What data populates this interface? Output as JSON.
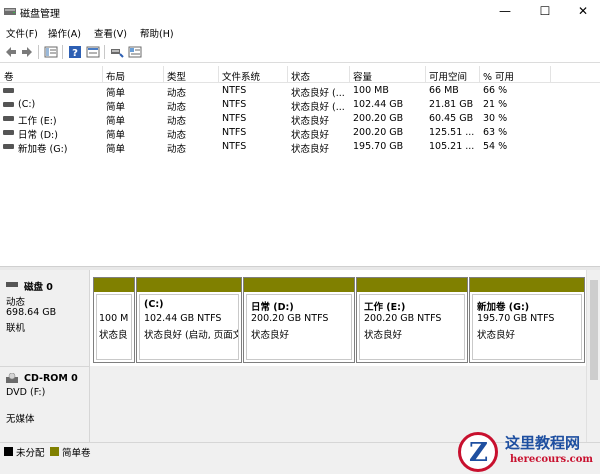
{
  "window": {
    "title": "磁盘管理",
    "minimize_glyph": "—",
    "maximize_glyph": "☐",
    "close_glyph": "✕"
  },
  "menu": [
    {
      "label": "文件(F)"
    },
    {
      "label": "操作(A)"
    },
    {
      "label": "查看(V)"
    },
    {
      "label": "帮助(H)"
    }
  ],
  "toolbar": {
    "icons": [
      "back-arrow-icon",
      "forward-arrow-icon",
      "properties-icon",
      "help-icon",
      "refresh-icon",
      "connect-icon",
      "options-icon"
    ]
  },
  "list": {
    "columns": [
      "卷",
      "布局",
      "类型",
      "文件系统",
      "状态",
      "容量",
      "可用空间",
      "% 可用"
    ],
    "rows": [
      {
        "volume": "",
        "layout": "简单",
        "type": "动态",
        "fs": "NTFS",
        "status": "状态良好 (...",
        "capacity": "100 MB",
        "free": "66 MB",
        "pct": "66 %"
      },
      {
        "volume": "(C:)",
        "layout": "简单",
        "type": "动态",
        "fs": "NTFS",
        "status": "状态良好 (...",
        "capacity": "102.44 GB",
        "free": "21.81 GB",
        "pct": "21 %"
      },
      {
        "volume": "工作 (E:)",
        "layout": "简单",
        "type": "动态",
        "fs": "NTFS",
        "status": "状态良好",
        "capacity": "200.20 GB",
        "free": "60.45 GB",
        "pct": "30 %"
      },
      {
        "volume": "日常 (D:)",
        "layout": "简单",
        "type": "动态",
        "fs": "NTFS",
        "status": "状态良好",
        "capacity": "200.20 GB",
        "free": "125.51 ...",
        "pct": "63 %"
      },
      {
        "volume": "新加卷 (G:)",
        "layout": "简单",
        "type": "动态",
        "fs": "NTFS",
        "status": "状态良好",
        "capacity": "195.70 GB",
        "free": "105.21 ...",
        "pct": "54 %"
      }
    ]
  },
  "disk0": {
    "name": "磁盘 0",
    "kind": "动态",
    "size": "698.64 GB",
    "state": "联机",
    "partitions": [
      {
        "name": "",
        "size_fs": "100 M",
        "status": "状态良"
      },
      {
        "name": "(C:)",
        "size_fs": "102.44 GB NTFS",
        "status": "状态良好 (启动, 页面文"
      },
      {
        "name": "日常  (D:)",
        "size_fs": "200.20 GB NTFS",
        "status": "状态良好"
      },
      {
        "name": "工作  (E:)",
        "size_fs": "200.20 GB NTFS",
        "status": "状态良好"
      },
      {
        "name": "新加卷  (G:)",
        "size_fs": "195.70 GB NTFS",
        "status": "状态良好"
      }
    ]
  },
  "cdrom0": {
    "name": "CD-ROM 0",
    "drive": "DVD (F:)",
    "media": "无媒体"
  },
  "legend": [
    {
      "label": "未分配",
      "color": "#000000"
    },
    {
      "label": "简单卷",
      "color": "#808000"
    }
  ],
  "watermark": {
    "title": "这里教程网",
    "url": "herecours.com",
    "logo_letter": "Z"
  },
  "colors": {
    "partition_bar": "#808000",
    "unallocated": "#000000"
  }
}
